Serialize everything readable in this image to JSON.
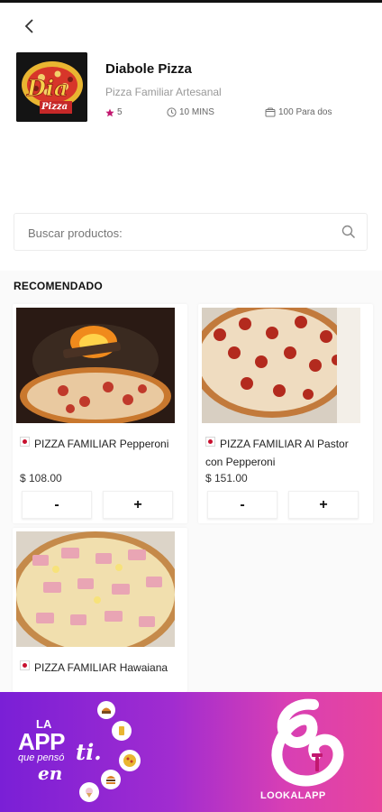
{
  "restaurant": {
    "name": "Diabole Pizza",
    "tagline": "Pizza Familiar Artesanal",
    "rating": "5",
    "delivery_time": "10 MINS",
    "price_for_two": "100 Para dos",
    "logo_text": "Pizza"
  },
  "search": {
    "placeholder": "Buscar productos:"
  },
  "section_title": "RECOMENDADO",
  "products": [
    {
      "name": "PIZZA FAMILIAR Pepperoni",
      "price": "$ 108.00",
      "minus": "-",
      "plus": "+"
    },
    {
      "name": "PIZZA FAMILIAR Al Pastor con Pepperoni",
      "price": "$ 151.00",
      "minus": "-",
      "plus": "+"
    },
    {
      "name": "PIZZA FAMILIAR Hawaiana"
    }
  ],
  "banner": {
    "slogan_la": "LA",
    "slogan_app": "APP",
    "slogan_que": "que pensó",
    "slogan_en": "en",
    "slogan_ti": "ti.",
    "brand": "LOOKALAPP"
  },
  "colors": {
    "accent": "#c2186f",
    "banner_start": "#7a1fd6",
    "banner_end": "#e8459c",
    "flag_red": "#c8102e"
  }
}
